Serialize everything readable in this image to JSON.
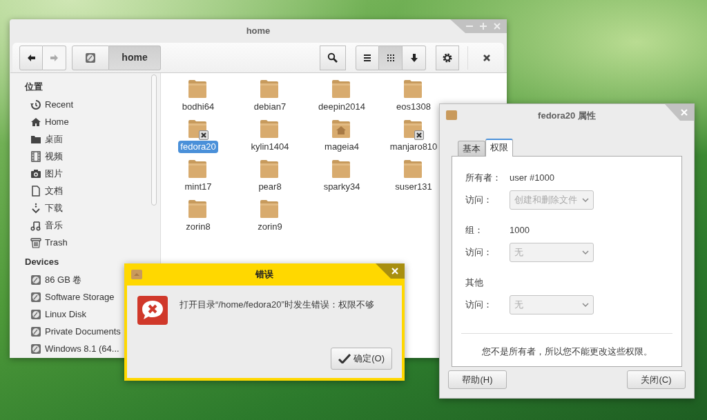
{
  "file_manager": {
    "title": "home",
    "toolbar": {
      "back": {
        "disabled": false
      },
      "forward": {
        "disabled": true
      },
      "path": [
        {
          "kind": "disk",
          "selected": false
        },
        {
          "kind": "text",
          "label": "home",
          "selected": true
        }
      ],
      "views": [
        {
          "kind": "list",
          "selected": false
        },
        {
          "kind": "grid",
          "selected": true
        },
        {
          "kind": "sort",
          "selected": false
        }
      ]
    },
    "sidebar": [
      {
        "heading": "位置",
        "items": [
          {
            "label": "Recent",
            "kind": "recent"
          },
          {
            "label": "Home",
            "kind": "home"
          },
          {
            "label": "桌面",
            "kind": "folder"
          },
          {
            "label": "视频",
            "kind": "film"
          },
          {
            "label": "图片",
            "kind": "camera"
          },
          {
            "label": "文档",
            "kind": "document"
          },
          {
            "label": "下载",
            "kind": "download"
          },
          {
            "label": "音乐",
            "kind": "music"
          },
          {
            "label": "Trash",
            "kind": "trash"
          }
        ]
      },
      {
        "heading": "Devices",
        "items": [
          {
            "label": "86 GB 卷",
            "kind": "disk"
          },
          {
            "label": "Software Storage",
            "kind": "disk"
          },
          {
            "label": "Linux Disk",
            "kind": "disk"
          },
          {
            "label": "Private Documents",
            "kind": "disk"
          },
          {
            "label": "Windows 8.1 (64...",
            "kind": "disk"
          }
        ]
      }
    ],
    "files": [
      {
        "name": "bodhi64",
        "kind": "plain",
        "selected": false
      },
      {
        "name": "debian7",
        "kind": "plain",
        "selected": false
      },
      {
        "name": "deepin2014",
        "kind": "plain",
        "selected": false
      },
      {
        "name": "eos1308",
        "kind": "plain",
        "selected": false
      },
      {
        "name": "fedora20",
        "kind": "locked",
        "selected": true
      },
      {
        "name": "kylin1404",
        "kind": "plain",
        "selected": false
      },
      {
        "name": "mageia4",
        "kind": "home",
        "selected": false
      },
      {
        "name": "manjaro810",
        "kind": "locked",
        "selected": false
      },
      {
        "name": "mint17",
        "kind": "plain",
        "selected": false
      },
      {
        "name": "pear8",
        "kind": "plain",
        "selected": false
      },
      {
        "name": "sparky34",
        "kind": "plain",
        "selected": false
      },
      {
        "name": "suser131",
        "kind": "plain",
        "selected": false
      },
      {
        "name": "zorin8",
        "kind": "plain",
        "selected": false
      },
      {
        "name": "zorin9",
        "kind": "plain",
        "selected": false
      }
    ]
  },
  "properties": {
    "title": "fedora20 属性",
    "tabs": [
      {
        "label": "基本",
        "selected": false
      },
      {
        "label": "权限",
        "selected": true
      }
    ],
    "groups": [
      {
        "label": "所有者：",
        "value": "user #1000",
        "access_label": "访问：",
        "access": "创建和删除文件",
        "disabled": true
      },
      {
        "label": "组：",
        "value": "1000",
        "access_label": "访问：",
        "access": "无",
        "disabled": true
      },
      {
        "label": "其他",
        "access_label": "访问：",
        "access": "无",
        "disabled": true
      }
    ],
    "note": "您不是所有者，所以您不能更改这些权限。",
    "buttons": [
      "帮助(H)",
      "关闭(C)"
    ]
  },
  "error_dialog": {
    "title": "错误",
    "message": "打开目录“/home/fedora20”时发生错误：权限不够",
    "button": "确定(O)"
  }
}
